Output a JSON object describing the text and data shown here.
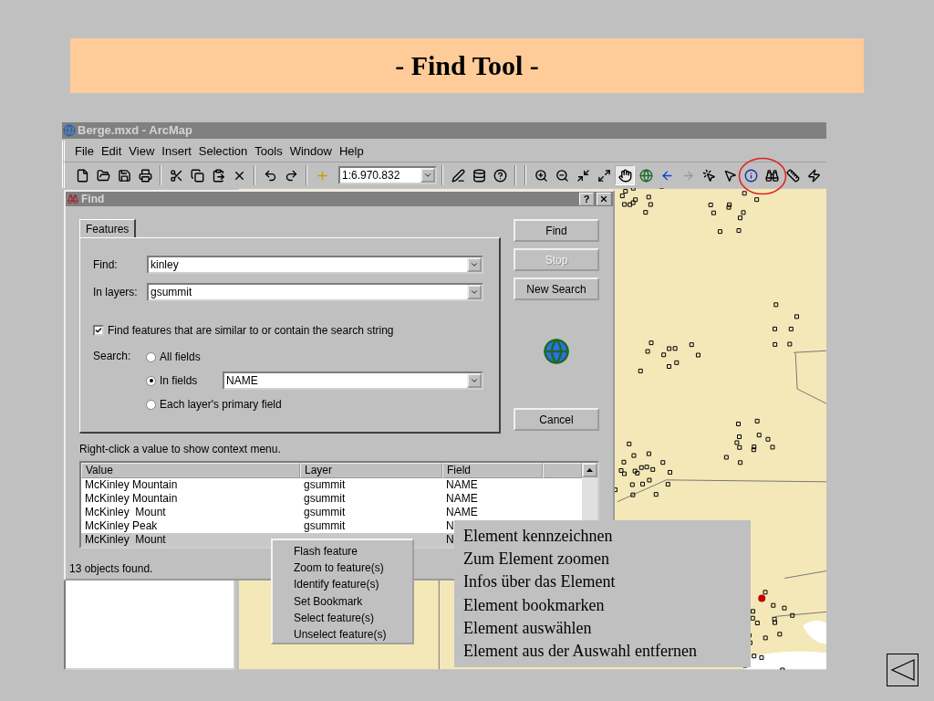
{
  "slide_title": "- Find Tool -",
  "app": {
    "title": "Berge.mxd - ArcMap",
    "menu": [
      "File",
      "Edit",
      "View",
      "Insert",
      "Selection",
      "Tools",
      "Window",
      "Help"
    ],
    "scale": "1:6.970.832"
  },
  "dialog": {
    "title": "Find",
    "help": "?",
    "tabs": [
      {
        "label": "Features",
        "selected": true
      }
    ],
    "find": {
      "label": "Find:",
      "value": "kinley"
    },
    "layers": {
      "label": "In layers:",
      "value": "gsummit"
    },
    "similar": {
      "label": "Find features that are similar to or contain the search string",
      "checked": true
    },
    "search": {
      "label": "Search:",
      "options": [
        {
          "label": "All fields",
          "selected": false
        },
        {
          "label": "In fields",
          "selected": true,
          "field": "NAME"
        },
        {
          "label": "Each layer's primary field",
          "selected": false
        }
      ]
    },
    "buttons": [
      {
        "label": "Find",
        "disabled": false
      },
      {
        "label": "Stop",
        "disabled": true
      },
      {
        "label": "New Search",
        "disabled": false
      }
    ],
    "cancel": {
      "label": "Cancel",
      "disabled": false
    },
    "hint": "Right-click a value to show context menu.",
    "results": {
      "columns": [
        "Value",
        "Layer",
        "Field"
      ],
      "rows": [
        {
          "value": "McKinley Mountain",
          "layer": "gsummit",
          "field": "NAME",
          "selected": false
        },
        {
          "value": "McKinley Mountain",
          "layer": "gsummit",
          "field": "NAME",
          "selected": false
        },
        {
          "value": "McKinley  Mount",
          "layer": "gsummit",
          "field": "NAME",
          "selected": false
        },
        {
          "value": "McKinley Peak",
          "layer": "gsummit",
          "field": "N",
          "selected": false
        },
        {
          "value": "McKinley  Mount",
          "field": "N",
          "selected": true
        }
      ]
    },
    "status": "13 objects found."
  },
  "context_menu": [
    "Flash feature",
    "Zoom to feature(s)",
    "Identify feature(s)",
    "Set Bookmark",
    "Select feature(s)",
    "Unselect feature(s)"
  ],
  "callout": [
    "Element kennzeichnen",
    "Zum Element zoomen",
    "Infos über das Element",
    "Element bookmarken",
    "Element auswählen",
    "Element aus der Auswahl entfernen"
  ]
}
